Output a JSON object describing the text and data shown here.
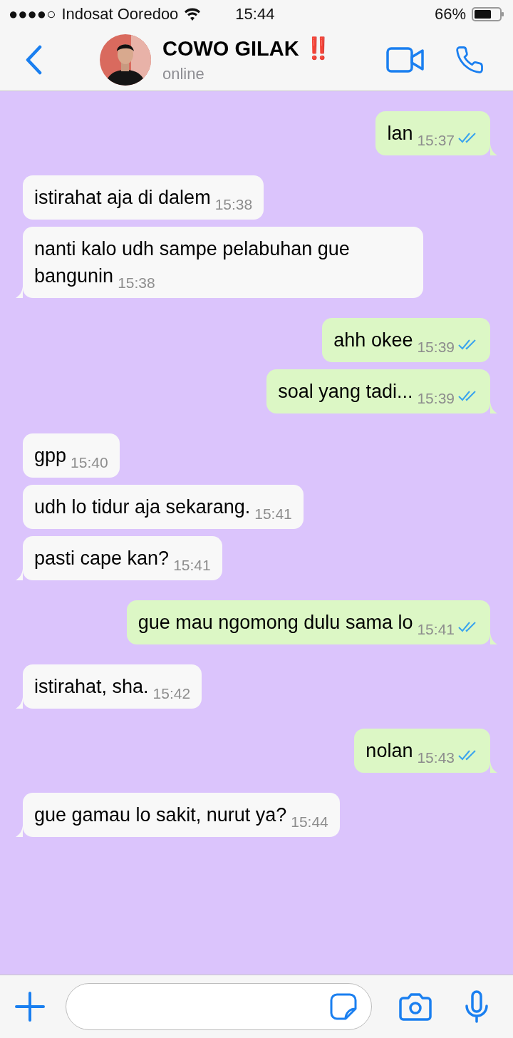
{
  "status_bar": {
    "signal_dots": "●●●●○",
    "carrier": "Indosat Ooredoo",
    "time": "15:44",
    "battery": "66%"
  },
  "header": {
    "contact_name": "COWO GILAK",
    "emoji": "‼️",
    "status": "online"
  },
  "messages": [
    {
      "kind": "sent",
      "text": "lan",
      "time": "15:37",
      "read": true
    },
    {
      "kind": "received",
      "text": "istirahat aja di dalem",
      "time": "15:38"
    },
    {
      "kind": "received",
      "text": "nanti kalo udh sampe pelabuhan gue bangunin",
      "time": "15:38"
    },
    {
      "kind": "sent",
      "text": "ahh okee",
      "time": "15:39",
      "read": true
    },
    {
      "kind": "sent",
      "text": "soal yang tadi...",
      "time": "15:39",
      "read": true
    },
    {
      "kind": "received",
      "text": "gpp",
      "time": "15:40"
    },
    {
      "kind": "received",
      "text": "udh lo tidur aja sekarang.",
      "time": "15:41"
    },
    {
      "kind": "received",
      "text": "pasti cape kan?",
      "time": "15:41"
    },
    {
      "kind": "sent",
      "text": "gue mau ngomong dulu sama lo",
      "time": "15:41",
      "read": true
    },
    {
      "kind": "received",
      "text": "istirahat, sha.",
      "time": "15:42"
    },
    {
      "kind": "sent",
      "text": "nolan",
      "time": "15:43",
      "read": true
    },
    {
      "kind": "received",
      "text": "gue gamau lo sakit, nurut ya?",
      "time": "15:44"
    }
  ]
}
